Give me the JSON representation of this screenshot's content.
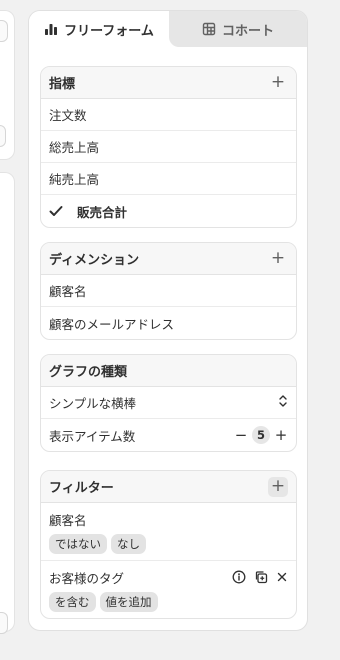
{
  "tabs": [
    {
      "label": "フリーフォーム",
      "icon": "bar-chart-icon",
      "active": true
    },
    {
      "label": "コホート",
      "icon": "cohort-grid-icon",
      "active": false
    }
  ],
  "metrics": {
    "title": "指標",
    "items": [
      {
        "label": "注文数",
        "selected": false
      },
      {
        "label": "総売上高",
        "selected": false
      },
      {
        "label": "純売上高",
        "selected": false
      },
      {
        "label": "販売合計",
        "selected": true
      }
    ]
  },
  "dimensions": {
    "title": "ディメンション",
    "items": [
      {
        "label": "顧客名"
      },
      {
        "label": "顧客のメールアドレス"
      }
    ]
  },
  "chart_type": {
    "title": "グラフの種類",
    "selected_value": "シンプルな横棒",
    "items_label": "表示アイテム数",
    "items_count": "5",
    "minus_label": "−",
    "plus_label": "+"
  },
  "filters": {
    "title": "フィルター",
    "items": [
      {
        "label": "顧客名",
        "chips": [
          "ではない",
          "なし"
        ]
      },
      {
        "label": "お客様のタグ",
        "chips": [
          "を含む",
          "値を追加"
        ]
      }
    ]
  },
  "colors": {
    "accent_text": "#303030",
    "inactive_tab": "#e6e6e6",
    "card_header": "#f7f7f7"
  }
}
